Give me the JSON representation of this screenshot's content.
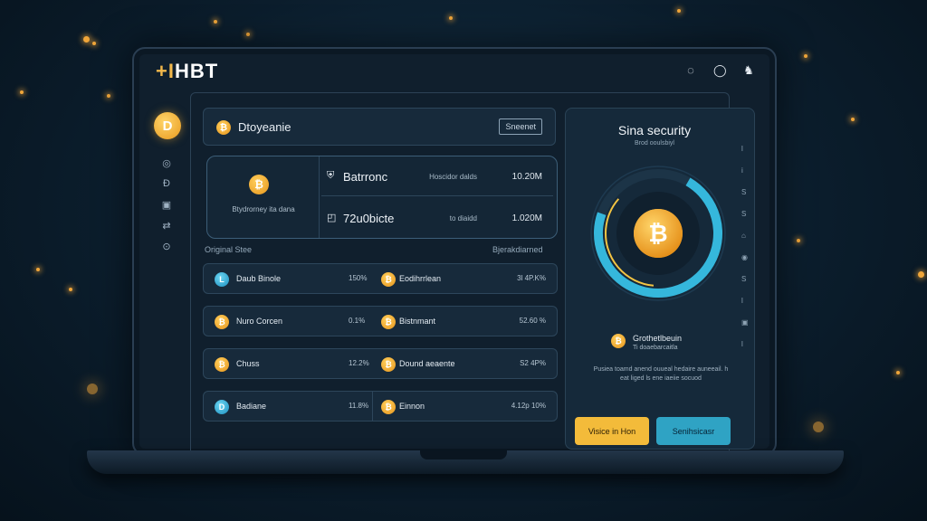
{
  "app": {
    "logo": "HBT",
    "logo_prefix": "+I"
  },
  "top_icons": [
    "clock-icon",
    "chat-icon",
    "user-icon"
  ],
  "sidebar": {
    "avatar_glyph": "D",
    "icons": [
      "shield-icon",
      "exchange-icon",
      "wallet-icon",
      "transfer-icon",
      "settings-icon"
    ]
  },
  "header": {
    "coin_glyph": "₿",
    "title": "Dtoyeanie",
    "button": "Sneenet"
  },
  "wallet": {
    "coin_glyph": "₿",
    "description": "Btydrorney ita dana",
    "rows": [
      {
        "icon": "⛨",
        "name": "Batrronc",
        "label": "Hoscidor dalds",
        "value": "10.20M"
      },
      {
        "icon": "◰",
        "name": "72u0bicte",
        "label": "to diaidd",
        "value": "1.020M"
      }
    ]
  },
  "section": {
    "left_label": "Original Stee",
    "right_label": "Bjerakdiarned"
  },
  "rows": [
    {
      "c1": "L",
      "c1_style": "blue",
      "n1": "Daub Binole",
      "v1": "150%",
      "c2": "₿",
      "n2": "Eodihrrlean",
      "v2": "3l 4P.K%"
    },
    {
      "c1": "₿",
      "c1_style": "gold",
      "n1": "Nuro Corcen",
      "v1": "0.1%",
      "c2": "₿",
      "n2": "Bistnmant",
      "v2": "52.60 %"
    },
    {
      "c1": "₿",
      "c1_style": "gold",
      "n1": "Chuss",
      "v1": "12.2%",
      "c2": "₿",
      "n2": "Dound aeaente",
      "v2": "S2 4P%"
    },
    {
      "c1": "D",
      "c1_style": "blue",
      "n1": "Badiane",
      "v1": "11.8%",
      "c2": "₿",
      "n2": "Einnon",
      "v2": "4.12p 10%"
    }
  ],
  "security": {
    "title": "Sina security",
    "subtitle": "Brod ooulsbiyl",
    "coin_glyph": "₿",
    "gauge_value_fraction": 0.72,
    "scroll_glyphs": [
      "l",
      "i",
      "S",
      "S",
      "⌂",
      "◉",
      "S",
      "l",
      "▣",
      "l"
    ],
    "tip_title": "Grothetlbeuin",
    "tip_sub": "Ti doaebarcaitla",
    "description": "Pusiea toamd anend ouueal hedaire auneeail. h eat liged ls ene iaeiie socuod",
    "btn_primary": "Visice in Hon",
    "btn_secondary": "Senihsicasr"
  },
  "colors": {
    "accent_gold": "#f3bb3a",
    "accent_teal": "#2fa3c4",
    "background": "#0b1d2c"
  }
}
